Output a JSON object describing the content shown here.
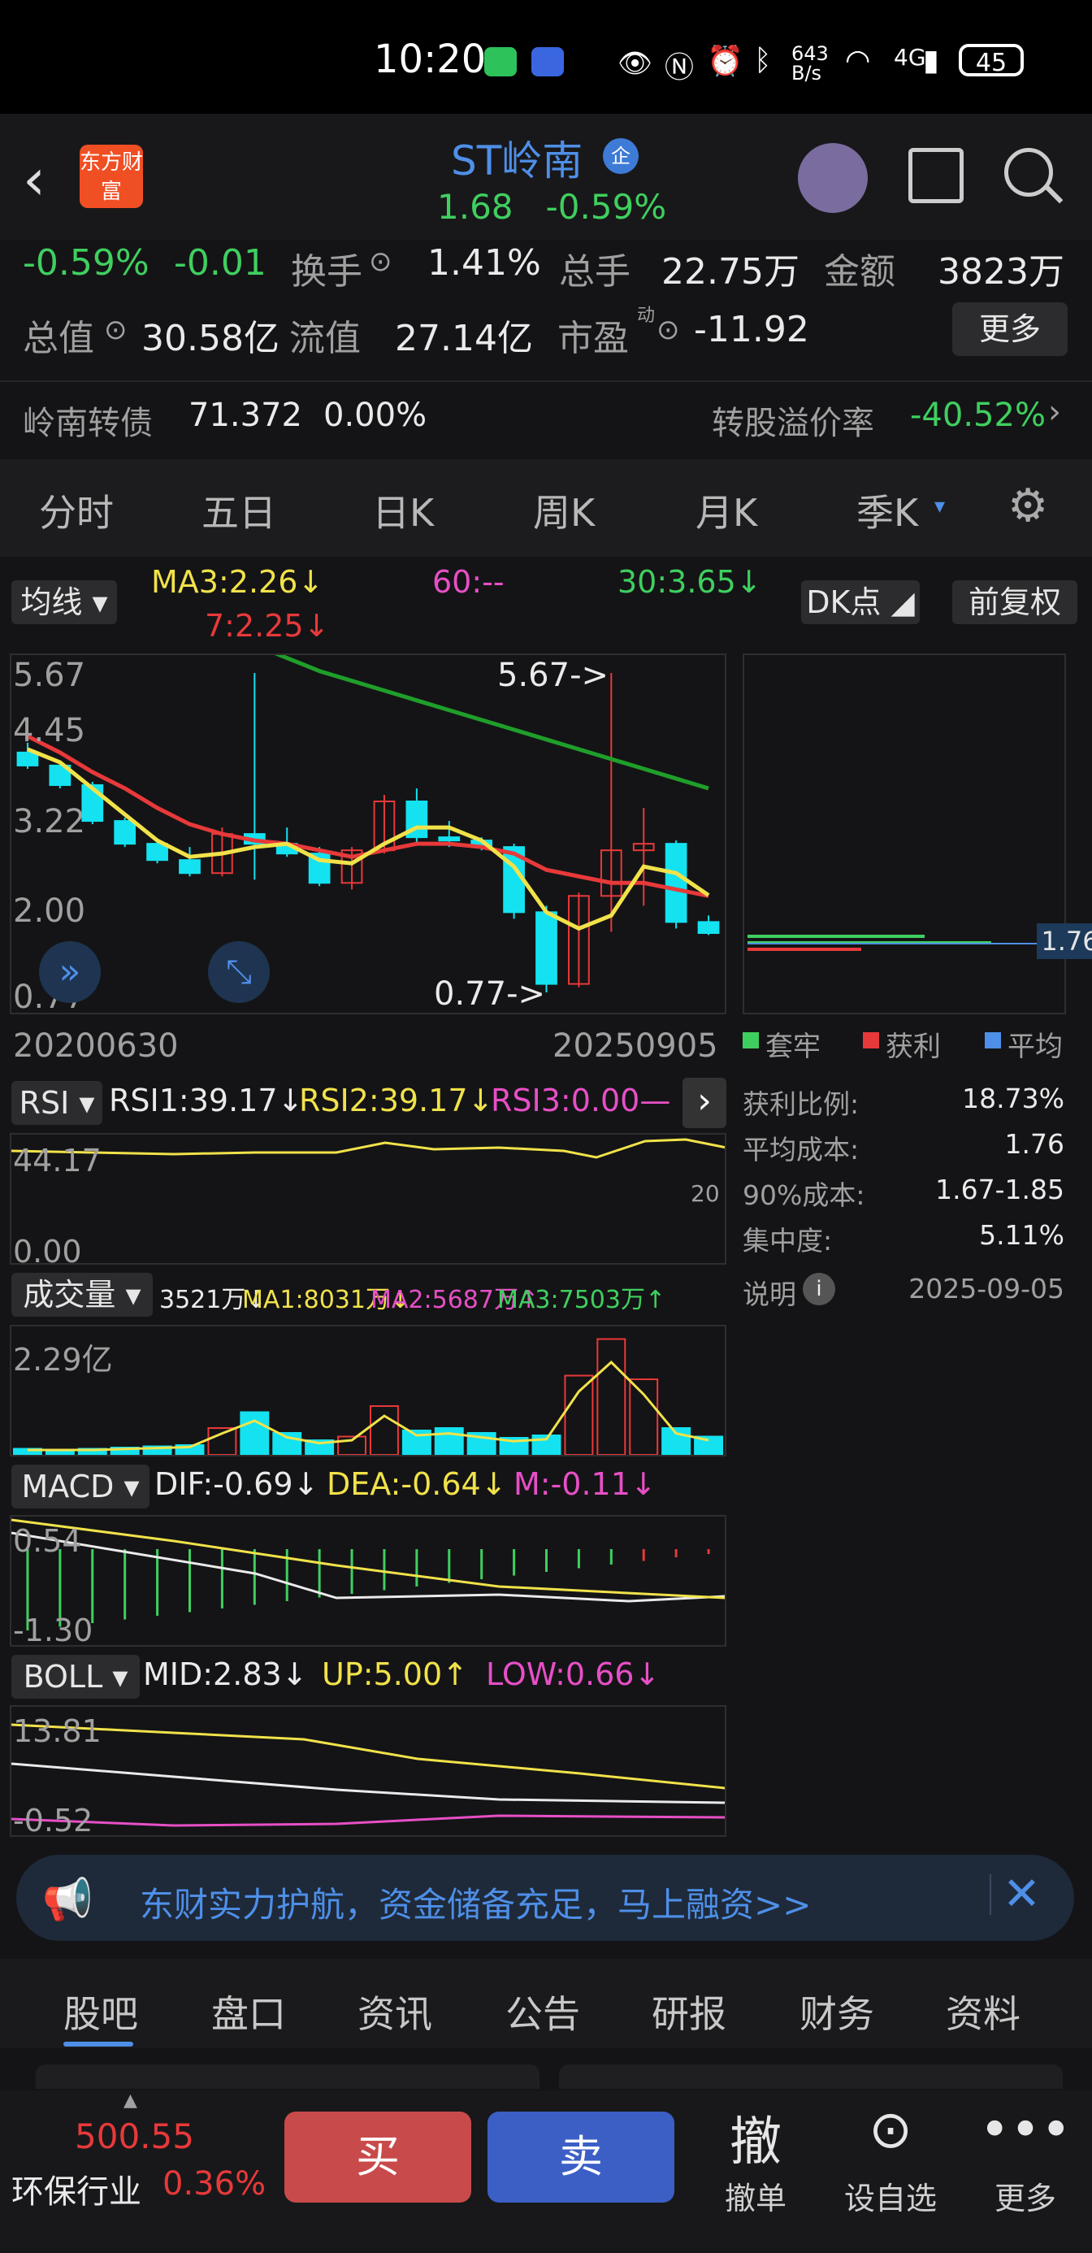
{
  "status": {
    "time": "10:20",
    "net_speed": "643 B/s",
    "battery": "45",
    "signal": "4G"
  },
  "header": {
    "logo_text": "东方财富",
    "title": "ST岭南",
    "badge": "企",
    "price": "1.68",
    "change_pct": "-0.59%"
  },
  "stats": {
    "pct": "-0.59%",
    "chg": "-0.01",
    "turnover_label": "换手",
    "turnover": "1.41%",
    "volume_label": "总手",
    "volume": "22.75万",
    "amount_label": "金额",
    "amount": "3823万",
    "mktcap_label": "总值",
    "mktcap": "30.58亿",
    "float_label": "流值",
    "float": "27.14亿",
    "pe_label": "市盈",
    "pe_sup": "动",
    "pe": "-11.92",
    "more": "更多"
  },
  "bond": {
    "name": "岭南转债",
    "price": "71.372",
    "pct": "0.00%",
    "premium_label": "转股溢价率",
    "premium": "-40.52%"
  },
  "tabs": [
    "分时",
    "五日",
    "日K",
    "周K",
    "月K",
    "季K"
  ],
  "active_tab": "季K",
  "ma": {
    "selector": "均线",
    "ma3": "MA3:2.26↓",
    "ma7": "7:2.25↓",
    "ma60": "60:--",
    "ma30": "30:3.65↓",
    "dk": "DK点",
    "fq": "前复权"
  },
  "kline": {
    "y_ticks": [
      "5.67",
      "4.45",
      "3.22",
      "2.00",
      "0.77"
    ],
    "high_annot": "5.67->",
    "low_annot": "0.77->",
    "date_start": "20200630",
    "date_end": "20250905"
  },
  "chip": {
    "price_tag": "1.76",
    "legend": [
      "套牢",
      "获利",
      "平均"
    ],
    "rows": [
      {
        "label": "获利比例:",
        "value": "18.73%"
      },
      {
        "label": "平均成本:",
        "value": "1.76"
      },
      {
        "label": "90%成本:",
        "value": "1.67-1.85"
      },
      {
        "label": "集中度:",
        "value": "5.11%"
      }
    ],
    "note_label": "说明",
    "date": "2025-09-05"
  },
  "rsi": {
    "selector": "RSI",
    "rsi1": "RSI1:39.17↓",
    "rsi2": "RSI2:39.17↓",
    "rsi3": "RSI3:0.00—",
    "top": "44.17",
    "bottom": "0.00",
    "right": "20"
  },
  "volume": {
    "selector": "成交量",
    "v": "3521万↓",
    "ma1": "MA1:8031万↓",
    "ma2": "MA2:5687万↑",
    "ma3": "MA3:7503万↑",
    "top": "2.29亿"
  },
  "macd": {
    "selector": "MACD",
    "dif": "DIF:-0.69↓",
    "dea": "DEA:-0.64↓",
    "m": "M:-0.11↓",
    "top": "0.54",
    "bottom": "-1.30"
  },
  "boll": {
    "selector": "BOLL",
    "mid": "MID:2.83↓",
    "up": "UP:5.00↑",
    "low": "LOW:0.66↓",
    "top": "13.81",
    "bottom": "-0.52"
  },
  "ad": {
    "text": "东财实力护航，资金储备充足，马上融资>>"
  },
  "bottom_tabs": [
    "股吧",
    "盘口",
    "资讯",
    "公告",
    "研报",
    "财务",
    "资料"
  ],
  "bottom_active": "股吧",
  "bottom_bar": {
    "index_value": "500.55",
    "index_name": "环保行业",
    "index_pct": "0.36%",
    "buy": "买",
    "sell": "卖",
    "cancel": "撤单",
    "cancel_icon": "撤",
    "watch": "设自选",
    "more": "更多"
  },
  "colors": {
    "up": "#e8393a",
    "down": "#3fcf5f",
    "accent": "#4e8fe8",
    "cyan": "#14e2f0",
    "yellow": "#f1e24a",
    "pink": "#e74fc6"
  },
  "chart_data": {
    "type": "candlestick",
    "period": "quarterly",
    "candles": [
      {
        "o": 4.45,
        "h": 4.6,
        "l": 4.2,
        "c": 4.25
      },
      {
        "o": 4.25,
        "h": 4.3,
        "l": 3.9,
        "c": 3.95
      },
      {
        "o": 3.95,
        "h": 4.0,
        "l": 3.35,
        "c": 3.4
      },
      {
        "o": 3.4,
        "h": 3.45,
        "l": 3.0,
        "c": 3.05
      },
      {
        "o": 3.05,
        "h": 3.1,
        "l": 2.75,
        "c": 2.8
      },
      {
        "o": 2.8,
        "h": 3.0,
        "l": 2.55,
        "c": 2.6
      },
      {
        "o": 2.6,
        "h": 3.3,
        "l": 2.55,
        "c": 3.2
      },
      {
        "o": 3.2,
        "h": 5.67,
        "l": 2.5,
        "c": 3.05
      },
      {
        "o": 3.05,
        "h": 3.3,
        "l": 2.85,
        "c": 2.9
      },
      {
        "o": 2.9,
        "h": 3.0,
        "l": 2.4,
        "c": 2.45
      },
      {
        "o": 2.45,
        "h": 3.0,
        "l": 2.35,
        "c": 2.95
      },
      {
        "o": 2.95,
        "h": 3.8,
        "l": 2.9,
        "c": 3.7
      },
      {
        "o": 3.7,
        "h": 3.9,
        "l": 3.05,
        "c": 3.15
      },
      {
        "o": 3.15,
        "h": 3.4,
        "l": 3.0,
        "c": 3.1
      },
      {
        "o": 3.1,
        "h": 3.15,
        "l": 2.95,
        "c": 3.0
      },
      {
        "o": 3.0,
        "h": 3.05,
        "l": 1.9,
        "c": 2.0
      },
      {
        "o": 2.0,
        "h": 2.1,
        "l": 0.77,
        "c": 0.9
      },
      {
        "o": 0.9,
        "h": 2.3,
        "l": 0.85,
        "c": 2.25
      },
      {
        "o": 2.25,
        "h": 5.67,
        "l": 1.7,
        "c": 2.95
      },
      {
        "o": 2.95,
        "h": 3.6,
        "l": 2.1,
        "c": 3.05
      },
      {
        "o": 3.05,
        "h": 3.1,
        "l": 1.75,
        "c": 1.85
      },
      {
        "o": 1.85,
        "h": 1.95,
        "l": 1.65,
        "c": 1.68
      }
    ],
    "ma3": [
      4.5,
      4.3,
      3.9,
      3.5,
      3.1,
      2.85,
      2.9,
      3.0,
      3.05,
      2.8,
      2.75,
      3.05,
      3.3,
      3.3,
      3.1,
      2.7,
      2.0,
      1.75,
      1.95,
      2.7,
      2.6,
      2.26
    ],
    "ma7": [
      4.7,
      4.45,
      4.15,
      3.9,
      3.6,
      3.35,
      3.2,
      3.1,
      3.05,
      2.95,
      2.85,
      2.95,
      3.05,
      3.05,
      3.0,
      2.9,
      2.65,
      2.55,
      2.45,
      2.45,
      2.35,
      2.25
    ],
    "ma30": [
      6.3,
      6.1,
      5.9,
      5.7,
      5.55,
      5.4,
      5.25,
      5.1,
      4.95,
      4.8,
      4.65,
      4.5,
      4.35,
      4.2,
      4.05,
      3.9
    ],
    "y_range": [
      0.77,
      5.67
    ],
    "x_range": [
      "20200630",
      "20250905"
    ]
  }
}
